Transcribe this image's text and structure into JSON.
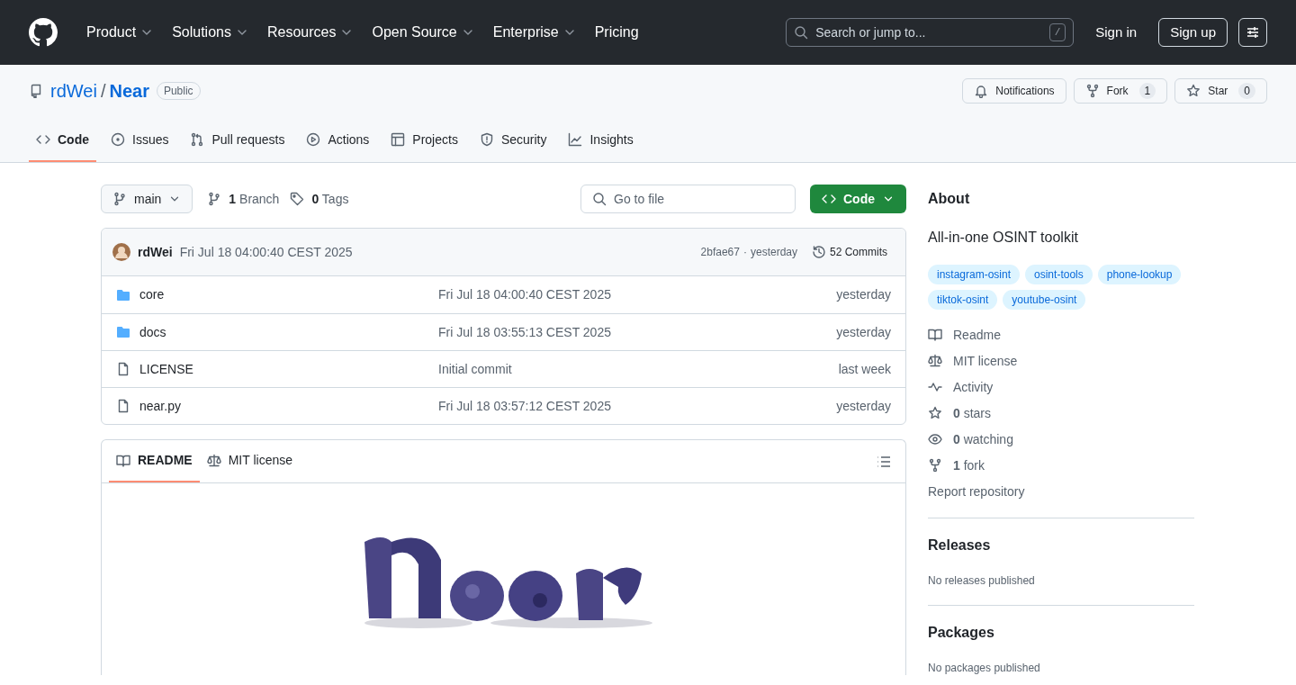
{
  "nav": {
    "items": [
      {
        "label": "Product",
        "dropdown": true
      },
      {
        "label": "Solutions",
        "dropdown": true
      },
      {
        "label": "Resources",
        "dropdown": true
      },
      {
        "label": "Open Source",
        "dropdown": true
      },
      {
        "label": "Enterprise",
        "dropdown": true
      },
      {
        "label": "Pricing",
        "dropdown": false
      }
    ],
    "search": {
      "placeholder": "Search or jump to...",
      "shortcut": "/"
    },
    "sign_in": "Sign in",
    "sign_up": "Sign up"
  },
  "repo": {
    "owner": "rdWei",
    "separator": "/",
    "name": "Near",
    "visibility": "Public",
    "actions": [
      {
        "kind": "notifications",
        "label": "Notifications"
      },
      {
        "kind": "fork",
        "label": "Fork",
        "count": "1"
      },
      {
        "kind": "star",
        "label": "Star",
        "count": "0"
      }
    ]
  },
  "tabs": [
    {
      "kind": "code",
      "label": "Code",
      "selected": true
    },
    {
      "kind": "issues",
      "label": "Issues",
      "selected": false
    },
    {
      "kind": "pulls",
      "label": "Pull requests",
      "selected": false
    },
    {
      "kind": "actions",
      "label": "Actions",
      "selected": false
    },
    {
      "kind": "projects",
      "label": "Projects",
      "selected": false
    },
    {
      "kind": "security",
      "label": "Security",
      "selected": false
    },
    {
      "kind": "insights",
      "label": "Insights",
      "selected": false
    }
  ],
  "toolbar": {
    "branch": "main",
    "branches": {
      "count": "1",
      "label": "Branch"
    },
    "tags": {
      "count": "0",
      "label": "Tags"
    },
    "goto": {
      "placeholder": "Go to file"
    },
    "code_button": "Code"
  },
  "latest_commit": {
    "author": "rdWei",
    "message": "Fri Jul 18 04:00:40 CEST 2025",
    "hash": "2bfae67",
    "separator": "·",
    "time": "yesterday",
    "commits": "52 Commits"
  },
  "files": [
    {
      "kind": "folder",
      "name": "core",
      "message": "Fri Jul 18 04:00:40 CEST 2025",
      "time": "yesterday"
    },
    {
      "kind": "folder",
      "name": "docs",
      "message": "Fri Jul 18 03:55:13 CEST 2025",
      "time": "yesterday"
    },
    {
      "kind": "file",
      "name": "LICENSE",
      "message": "Initial commit",
      "time": "last week"
    },
    {
      "kind": "file",
      "name": "near.py",
      "message": "Fri Jul 18 03:57:12 CEST 2025",
      "time": "yesterday"
    }
  ],
  "readme": {
    "tabs": [
      {
        "kind": "book",
        "label": "README",
        "selected": true
      },
      {
        "kind": "law",
        "label": "MIT license",
        "selected": false
      }
    ]
  },
  "about": {
    "title": "About",
    "description": "All-in-one OSINT toolkit",
    "topics": [
      "instagram-osint",
      "osint-tools",
      "phone-lookup",
      "tiktok-osint",
      "youtube-osint"
    ],
    "links": [
      {
        "kind": "book",
        "label": "Readme"
      },
      {
        "kind": "law",
        "label": "MIT license"
      },
      {
        "kind": "pulse",
        "label": "Activity"
      },
      {
        "kind": "star",
        "count": "0",
        "label": "stars"
      },
      {
        "kind": "eye",
        "count": "0",
        "label": "watching"
      },
      {
        "kind": "fork",
        "count": "1",
        "label": "fork"
      }
    ],
    "report": "Report repository"
  },
  "releases": {
    "title": "Releases",
    "note": "No releases published"
  },
  "packages": {
    "title": "Packages",
    "note": "No packages published"
  }
}
